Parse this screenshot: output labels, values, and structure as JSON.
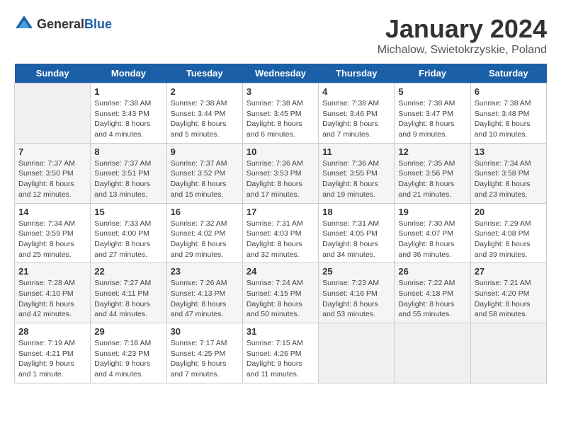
{
  "header": {
    "logo_general": "General",
    "logo_blue": "Blue",
    "title": "January 2024",
    "subtitle": "Michalow, Swietokrzyskie, Poland"
  },
  "weekdays": [
    "Sunday",
    "Monday",
    "Tuesday",
    "Wednesday",
    "Thursday",
    "Friday",
    "Saturday"
  ],
  "weeks": [
    [
      {
        "day": "",
        "info": ""
      },
      {
        "day": "1",
        "info": "Sunrise: 7:38 AM\nSunset: 3:43 PM\nDaylight: 8 hours\nand 4 minutes."
      },
      {
        "day": "2",
        "info": "Sunrise: 7:38 AM\nSunset: 3:44 PM\nDaylight: 8 hours\nand 5 minutes."
      },
      {
        "day": "3",
        "info": "Sunrise: 7:38 AM\nSunset: 3:45 PM\nDaylight: 8 hours\nand 6 minutes."
      },
      {
        "day": "4",
        "info": "Sunrise: 7:38 AM\nSunset: 3:46 PM\nDaylight: 8 hours\nand 7 minutes."
      },
      {
        "day": "5",
        "info": "Sunrise: 7:38 AM\nSunset: 3:47 PM\nDaylight: 8 hours\nand 9 minutes."
      },
      {
        "day": "6",
        "info": "Sunrise: 7:38 AM\nSunset: 3:48 PM\nDaylight: 8 hours\nand 10 minutes."
      }
    ],
    [
      {
        "day": "7",
        "info": "Sunrise: 7:37 AM\nSunset: 3:50 PM\nDaylight: 8 hours\nand 12 minutes."
      },
      {
        "day": "8",
        "info": "Sunrise: 7:37 AM\nSunset: 3:51 PM\nDaylight: 8 hours\nand 13 minutes."
      },
      {
        "day": "9",
        "info": "Sunrise: 7:37 AM\nSunset: 3:52 PM\nDaylight: 8 hours\nand 15 minutes."
      },
      {
        "day": "10",
        "info": "Sunrise: 7:36 AM\nSunset: 3:53 PM\nDaylight: 8 hours\nand 17 minutes."
      },
      {
        "day": "11",
        "info": "Sunrise: 7:36 AM\nSunset: 3:55 PM\nDaylight: 8 hours\nand 19 minutes."
      },
      {
        "day": "12",
        "info": "Sunrise: 7:35 AM\nSunset: 3:56 PM\nDaylight: 8 hours\nand 21 minutes."
      },
      {
        "day": "13",
        "info": "Sunrise: 7:34 AM\nSunset: 3:58 PM\nDaylight: 8 hours\nand 23 minutes."
      }
    ],
    [
      {
        "day": "14",
        "info": "Sunrise: 7:34 AM\nSunset: 3:59 PM\nDaylight: 8 hours\nand 25 minutes."
      },
      {
        "day": "15",
        "info": "Sunrise: 7:33 AM\nSunset: 4:00 PM\nDaylight: 8 hours\nand 27 minutes."
      },
      {
        "day": "16",
        "info": "Sunrise: 7:32 AM\nSunset: 4:02 PM\nDaylight: 8 hours\nand 29 minutes."
      },
      {
        "day": "17",
        "info": "Sunrise: 7:31 AM\nSunset: 4:03 PM\nDaylight: 8 hours\nand 32 minutes."
      },
      {
        "day": "18",
        "info": "Sunrise: 7:31 AM\nSunset: 4:05 PM\nDaylight: 8 hours\nand 34 minutes."
      },
      {
        "day": "19",
        "info": "Sunrise: 7:30 AM\nSunset: 4:07 PM\nDaylight: 8 hours\nand 36 minutes."
      },
      {
        "day": "20",
        "info": "Sunrise: 7:29 AM\nSunset: 4:08 PM\nDaylight: 8 hours\nand 39 minutes."
      }
    ],
    [
      {
        "day": "21",
        "info": "Sunrise: 7:28 AM\nSunset: 4:10 PM\nDaylight: 8 hours\nand 42 minutes."
      },
      {
        "day": "22",
        "info": "Sunrise: 7:27 AM\nSunset: 4:11 PM\nDaylight: 8 hours\nand 44 minutes."
      },
      {
        "day": "23",
        "info": "Sunrise: 7:26 AM\nSunset: 4:13 PM\nDaylight: 8 hours\nand 47 minutes."
      },
      {
        "day": "24",
        "info": "Sunrise: 7:24 AM\nSunset: 4:15 PM\nDaylight: 8 hours\nand 50 minutes."
      },
      {
        "day": "25",
        "info": "Sunrise: 7:23 AM\nSunset: 4:16 PM\nDaylight: 8 hours\nand 53 minutes."
      },
      {
        "day": "26",
        "info": "Sunrise: 7:22 AM\nSunset: 4:18 PM\nDaylight: 8 hours\nand 55 minutes."
      },
      {
        "day": "27",
        "info": "Sunrise: 7:21 AM\nSunset: 4:20 PM\nDaylight: 8 hours\nand 58 minutes."
      }
    ],
    [
      {
        "day": "28",
        "info": "Sunrise: 7:19 AM\nSunset: 4:21 PM\nDaylight: 9 hours\nand 1 minute."
      },
      {
        "day": "29",
        "info": "Sunrise: 7:18 AM\nSunset: 4:23 PM\nDaylight: 9 hours\nand 4 minutes."
      },
      {
        "day": "30",
        "info": "Sunrise: 7:17 AM\nSunset: 4:25 PM\nDaylight: 9 hours\nand 7 minutes."
      },
      {
        "day": "31",
        "info": "Sunrise: 7:15 AM\nSunset: 4:26 PM\nDaylight: 9 hours\nand 11 minutes."
      },
      {
        "day": "",
        "info": ""
      },
      {
        "day": "",
        "info": ""
      },
      {
        "day": "",
        "info": ""
      }
    ]
  ]
}
